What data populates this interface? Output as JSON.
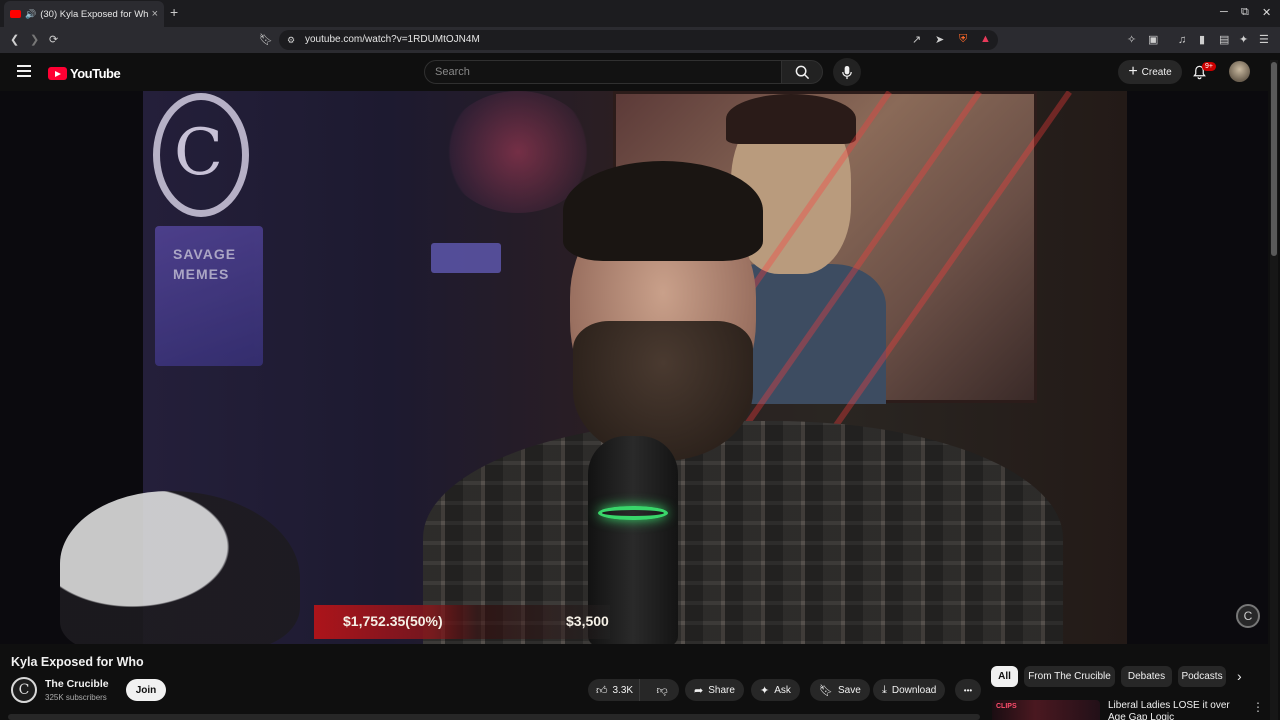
{
  "browser": {
    "tab_title": "(30) Kyla Exposed for Whe",
    "url": "youtube.com/watch?v=1RDUMtOJN4M",
    "tab_close": "×",
    "new_tab": "+"
  },
  "youtube": {
    "logo_text": "YouTube",
    "search_placeholder": "Search",
    "create_label": "Create",
    "notifications_badge": "9+"
  },
  "video": {
    "overlay_sign_text": "SAVAGE MEMES",
    "goal_current": "$1,752.35(50%)",
    "goal_target": "$3,500",
    "goal_progress": 0.5,
    "title": "Kyla Exposed for Who"
  },
  "channel": {
    "name": "The Crucible",
    "subscribers": "325K subscribers",
    "join_label": "Join",
    "avatar_letter": "C"
  },
  "actions": {
    "likes": "3.3K",
    "share": "Share",
    "ask": "Ask",
    "save": "Save",
    "download": "Download",
    "more": "•••"
  },
  "chips": [
    "All",
    "From The Crucible",
    "Debates",
    "Podcasts"
  ],
  "recommendation": {
    "thumb_text": "CLIPS",
    "title": "Liberal Ladies LOSE it over Age Gap Logic",
    "more": "⋮"
  },
  "colors": {
    "accent_red": "#ff0033",
    "goal_bar": "#b41419",
    "mic_ring": "#39d66a",
    "page_bg": "#0f0f0f"
  }
}
